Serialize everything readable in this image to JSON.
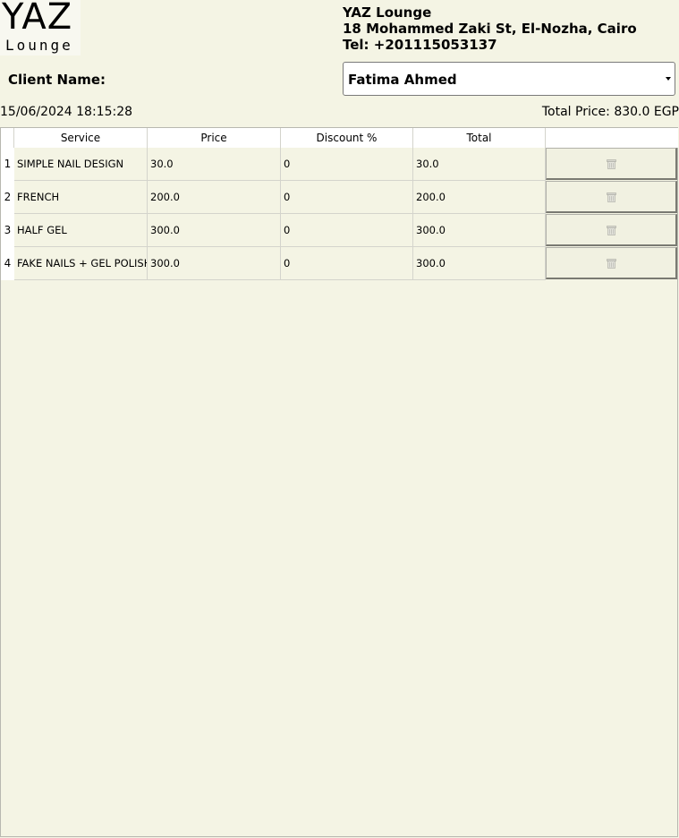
{
  "logo": {
    "main": "YAZ",
    "sub": "Lounge"
  },
  "business": {
    "name": "YAZ Lounge",
    "address": "18 Mohammed Zaki St, El-Nozha, Cairo",
    "phone": "Tel: +201115053137"
  },
  "client": {
    "label": "Client Name:",
    "selected": "Fatima Ahmed"
  },
  "datetime": "15/06/2024 18:15:28",
  "total_price": "Total Price: 830.0 EGP",
  "table": {
    "headers": [
      "Service",
      "Price",
      "Discount %",
      "Total",
      ""
    ],
    "rows": [
      {
        "num": "1",
        "service": "SIMPLE NAIL DESIGN",
        "price": "30.0",
        "discount": "0",
        "total": "30.0"
      },
      {
        "num": "2",
        "service": "FRENCH",
        "price": "200.0",
        "discount": "0",
        "total": "200.0"
      },
      {
        "num": "3",
        "service": "HALF GEL",
        "price": "300.0",
        "discount": "0",
        "total": "300.0"
      },
      {
        "num": "4",
        "service": "FAKE NAILS + GEL POLISH",
        "price": "300.0",
        "discount": "0",
        "total": "300.0"
      }
    ],
    "action_icon": "trash-icon"
  },
  "colors": {
    "background": "#f4f4e4",
    "header_bg": "#ffffff",
    "grid_line": "#d4d4cc"
  }
}
